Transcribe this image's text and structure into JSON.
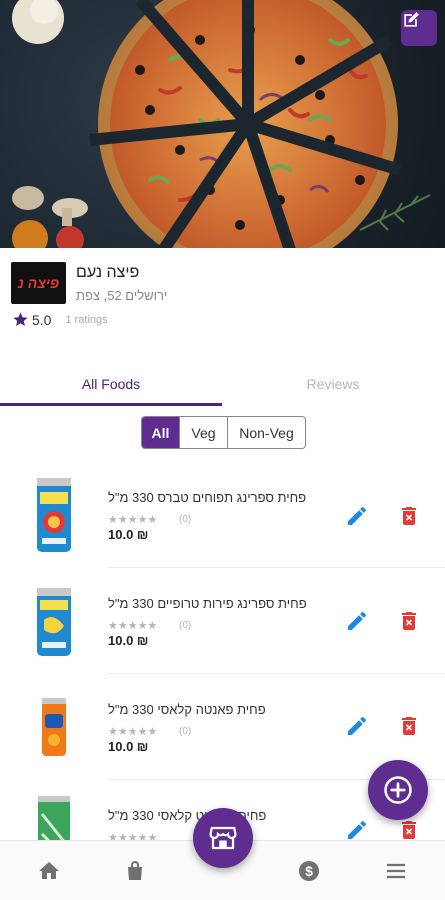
{
  "store": {
    "name": "פיצה נעם",
    "address": "ירושלים 52, צפת",
    "rating": "5.0",
    "ratings_count": "1 ratings",
    "logo_text": "פיצה נ"
  },
  "tabs": [
    {
      "label": "All Foods",
      "active": true
    },
    {
      "label": "Reviews",
      "active": false
    }
  ],
  "filter": {
    "options": [
      "All",
      "Veg",
      "Non-Veg"
    ],
    "selected": "All"
  },
  "foods": [
    {
      "name": "פחית ספרינג תפוחים טברס 330 מ\"ל",
      "stars": "★★★★★",
      "ratings": "(0)",
      "price": "10.0 ₪",
      "icon": "apple-can-icon"
    },
    {
      "name": "פחית ספרינג פירות טרופיים 330 מ\"ל",
      "stars": "★★★★★",
      "ratings": "(0)",
      "price": "10.0 ₪",
      "icon": "tropical-can-icon"
    },
    {
      "name": "פחית פאנטה קלאסי 330 מ\"ל",
      "stars": "★★★★★",
      "ratings": "(0)",
      "price": "10.0 ₪",
      "icon": "fanta-can-icon"
    },
    {
      "name": "פחית ספרייט קלאסי 330 מ\"ל",
      "stars": "★★★★★",
      "ratings": "(0)",
      "price": "",
      "icon": "sprite-can-icon"
    }
  ],
  "colors": {
    "accent": "#5e2d8f",
    "tab_active": "#4b2479",
    "edit_blue": "#1e88e5",
    "delete_red": "#e53935"
  },
  "bottom_nav": [
    "home-icon",
    "bag-icon",
    "store-icon",
    "dollar-icon",
    "menu-icon"
  ]
}
